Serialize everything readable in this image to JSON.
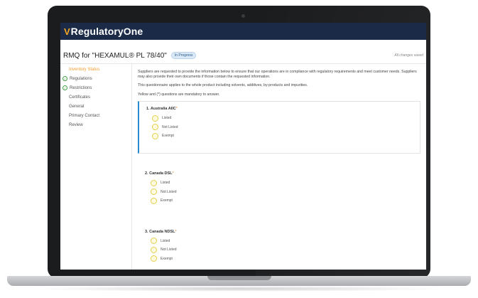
{
  "app": {
    "logo_mark": "V",
    "name": "RegulatoryOne"
  },
  "header": {
    "title": "RMQ for \"HEXAMUL® PL 78/40\"",
    "status": "In Progress",
    "saved_text": "All changes saved"
  },
  "sidebar": {
    "items": [
      {
        "label": "Inventory Status",
        "active": true,
        "done": false
      },
      {
        "label": "Regulations",
        "active": false,
        "done": true
      },
      {
        "label": "Restrictions",
        "active": false,
        "done": true
      },
      {
        "label": "Certificates",
        "active": false,
        "done": false
      },
      {
        "label": "General",
        "active": false,
        "done": false
      },
      {
        "label": "Primary Contact",
        "active": false,
        "done": false
      },
      {
        "label": "Review",
        "active": false,
        "done": false
      }
    ]
  },
  "intro": {
    "p1": "Suppliers are requested to provide the information below to ensure that our operations are in compliance with regulatory requirements and meet customer needs. Suppliers may also provide their own documents if those contain the requested information.",
    "p2": "This questionnaire applies to the whole product including solvents, additives, by-products and impurities.",
    "p3": "Yellow and (*) questions are mandatory to answer."
  },
  "questions": [
    {
      "title": "1. Australia AIIC",
      "required_mark": "*",
      "options": [
        "Listed",
        "Not Listed",
        "Exempt"
      ]
    },
    {
      "title": "2. Canada DSL",
      "required_mark": "*",
      "options": [
        "Listed",
        "Not Listed",
        "Exempt"
      ]
    },
    {
      "title": "3. Canada NDSL",
      "required_mark": "*",
      "options": [
        "Listed",
        "Not Listed",
        "Exempt"
      ]
    }
  ],
  "colors": {
    "brand_navy": "#1b2a47",
    "accent_orange": "#f39c2b",
    "focus_blue": "#2a8ad0",
    "mandatory_yellow": "#fffbe0"
  }
}
